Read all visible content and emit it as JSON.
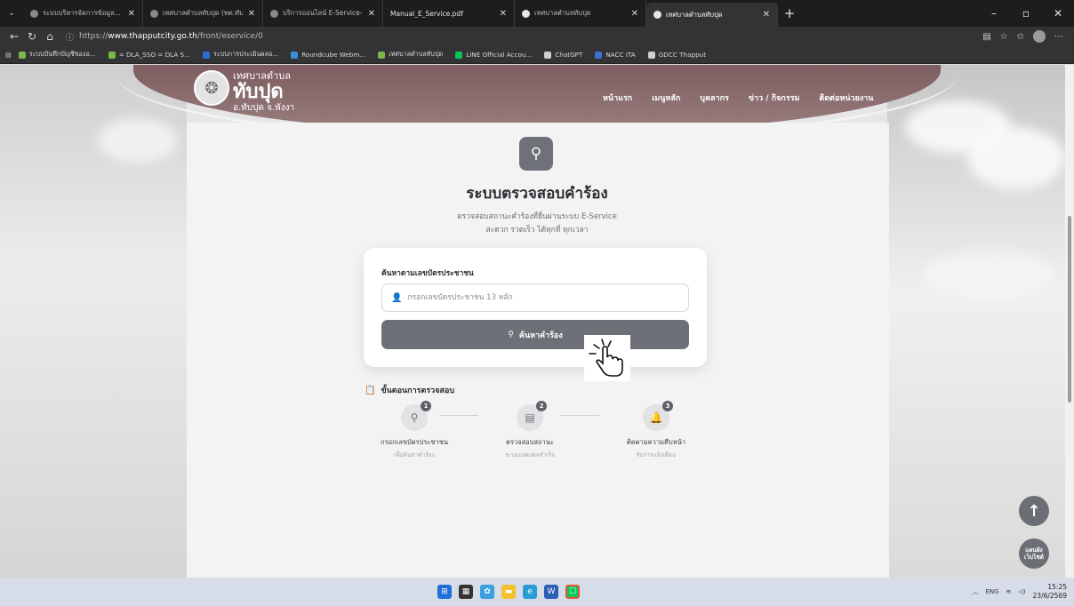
{
  "browser": {
    "tabs": [
      {
        "title": "ระบบบริหารจัดการข้อมูล...",
        "active": false,
        "size": "lg"
      },
      {
        "title": "เทศบาลตำบลทับปุด (ทต.ทับปุด)",
        "active": false,
        "size": "lg"
      },
      {
        "title": "บริการออนไลน์ E-Service-เทศบาล",
        "active": false,
        "size": "lg"
      },
      {
        "title": "Manual_E_Service.pdf",
        "active": false,
        "size": "lg"
      },
      {
        "title": "เทศบาลตำบลทับปุด",
        "active": false,
        "size": "lg"
      },
      {
        "title": "เทศบาลตำบลทับปุด",
        "active": true,
        "size": "lg"
      }
    ],
    "url_prefix": "https://",
    "url_host": "www.thapputcity.go.th",
    "url_path": "/front/eservice/0",
    "bookmarks": [
      {
        "label": "ระบบบันทึกบัญชีของอ...",
        "color": "#7ab648"
      },
      {
        "label": "= DLA_SSO = DLA S...",
        "color": "#7ab648"
      },
      {
        "label": "ระบบการประเมินผลอ...",
        "color": "#2d6bd1"
      },
      {
        "label": "Roundcube Webm...",
        "color": "#3b8fd9"
      },
      {
        "label": "เทศบาลตำบลทับปุด",
        "color": "#7ab648"
      },
      {
        "label": "LINE Official Accou...",
        "color": "#06c755"
      },
      {
        "label": "ChatGPT",
        "color": "#d0d0d0"
      },
      {
        "label": "NACC ITA",
        "color": "#3b6fd0"
      },
      {
        "label": "GDCC Thapput",
        "color": "#d0d0d0"
      }
    ]
  },
  "site": {
    "brand_line1": "เทศบาลตำบล",
    "brand_line2": "ทับปุด",
    "brand_line3": "อ.ทับปุด จ.พังงา",
    "nav": [
      "หน้าแรก",
      "เมนูหลัก",
      "บุคลากร",
      "ข่าว / กิจกรรม",
      "ติดต่อหน่วยงาน"
    ]
  },
  "main": {
    "title": "ระบบตรวจสอบคำร้อง",
    "subtitle1": "ตรวจสอบสถานะคำร้องที่ยื่นผ่านระบบ E-Service",
    "subtitle2": "สะดวก รวดเร็ว ได้ทุกที่ ทุกเวลา",
    "search": {
      "label": "ค้นหาตามเลขบัตรประชาชน",
      "placeholder": "กรอกเลขบัตรประชาชน 13 หลัก",
      "value": "",
      "button_label": "ค้นหาคำร้อง"
    },
    "steps_title": "ขั้นตอนการตรวจสอบ",
    "steps": [
      {
        "num": "1",
        "title": "กรอกเลขบัตรประชาชน",
        "desc": "เพื่อค้นหาคำร้อง",
        "icon": "search-icon"
      },
      {
        "num": "2",
        "title": "ตรวจสอบสถานะ",
        "desc": "ระบบแสดงผลสำเร็จ",
        "icon": "document-icon"
      },
      {
        "num": "3",
        "title": "ติดตามความคืบหน้า",
        "desc": "รับการแจ้งเตือน",
        "icon": "bell-icon"
      }
    ],
    "menu_fab_label": "แผนผังเว็บไซต์"
  },
  "taskbar": {
    "lang": "ENG",
    "time": "15:25",
    "date": "23/6/2569"
  }
}
